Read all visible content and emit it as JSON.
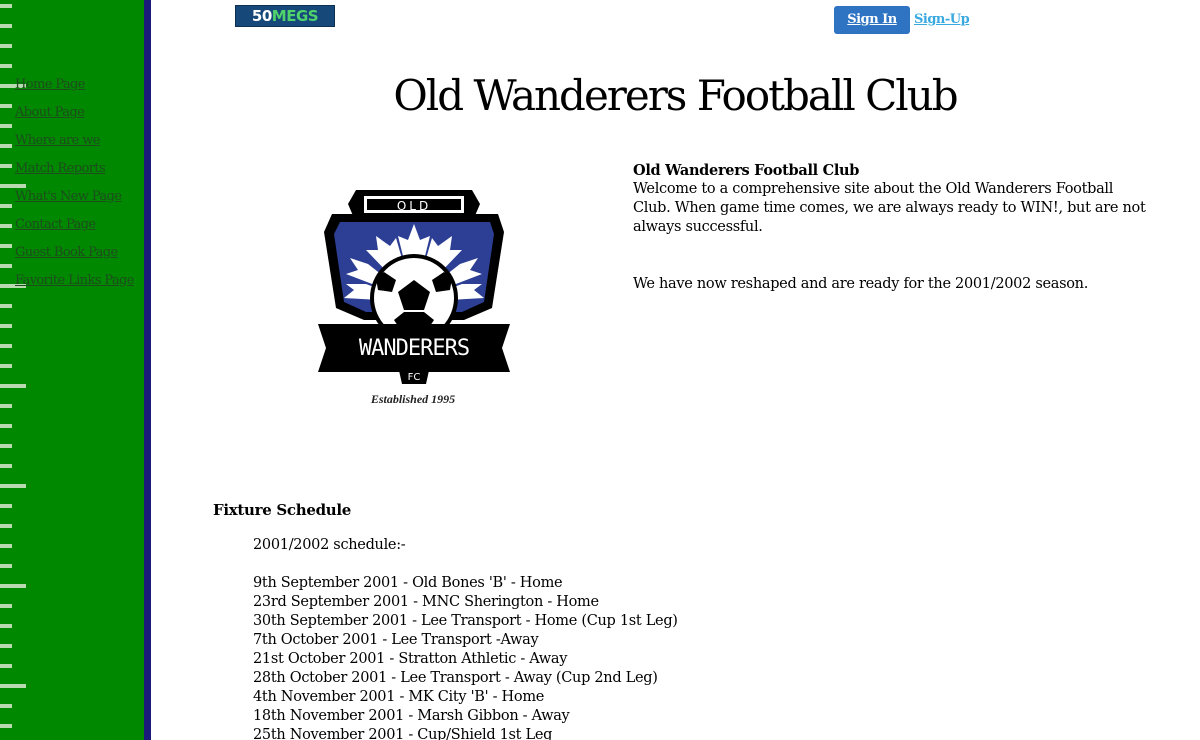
{
  "topbar": {
    "logo_prefix": "50",
    "logo_suffix": "MEGS",
    "signin_label": "Sign In",
    "signup_label": "Sign-Up"
  },
  "sidebar": {
    "items": [
      {
        "label": "Home Page"
      },
      {
        "label": "About Page"
      },
      {
        "label": "Where are we"
      },
      {
        "label": "Match Reports"
      },
      {
        "label": "What's New Page"
      },
      {
        "label": "Contact Page"
      },
      {
        "label": "Guest Book Page"
      },
      {
        "label": "Favorite Links Page"
      }
    ]
  },
  "main": {
    "title": "Old Wanderers Football Club",
    "crest": {
      "banner_text": "OLD",
      "name_text": "WANDERERS",
      "fc_text": "FC",
      "established": "Established 1995"
    },
    "intro": {
      "heading": "Old Wanderers Football Club",
      "text": "Welcome to a comprehensive site about the Old Wanderers Football Club. When game time comes, we are always ready to WIN!, but are not always successful.",
      "season": "We have now reshaped and are ready for the 2001/2002 season."
    },
    "fixtures": {
      "heading": "Fixture Schedule",
      "schedule_label": "2001/2002 schedule:-",
      "rows": [
        "9th September 2001 - Old Bones 'B' - Home",
        "23rd September 2001 - MNC Sherington - Home",
        "30th September 2001 - Lee Transport - Home (Cup 1st Leg)",
        "7th October 2001 - Lee Transport -Away",
        "21st October 2001 - Stratton Athletic - Away",
        "28th October 2001 - Lee Transport - Away (Cup 2nd Leg)",
        "4th November 2001 - MK City 'B' - Home",
        "18th November 2001 - Marsh Gibbon - Away",
        "25th November 2001 - Cup/Shield 1st Leg"
      ]
    }
  },
  "colors": {
    "sidebar_green": "#008800",
    "sidebar_rail": "#1a1a7a",
    "signin_blue": "#2e74c3",
    "signup_link": "#39a9e0",
    "crest_blue": "#2d3f94"
  },
  "icons": {
    "host_logo": "50megs-logo",
    "club_crest": "old-wanderers-crest-icon"
  }
}
